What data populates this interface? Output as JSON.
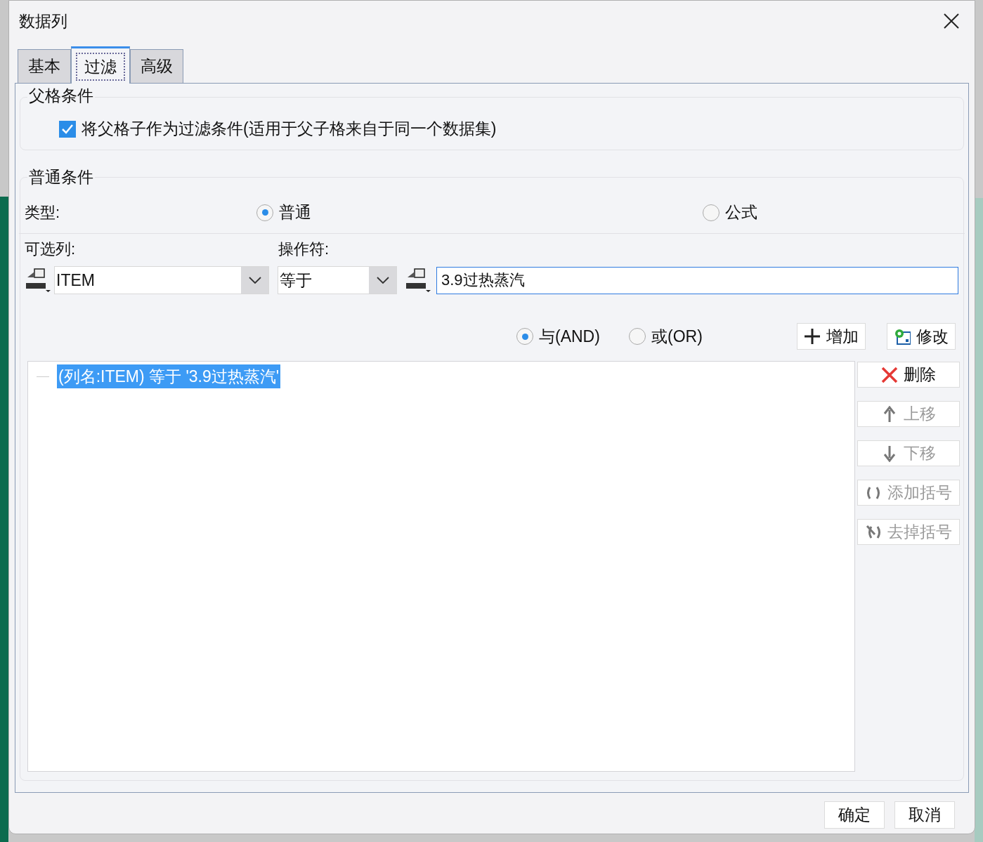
{
  "window": {
    "title": "数据列"
  },
  "tabs": [
    {
      "label": "基本",
      "selected": false
    },
    {
      "label": "过滤",
      "selected": true
    },
    {
      "label": "高级",
      "selected": false
    }
  ],
  "parent_condition": {
    "title": "父格条件",
    "checkbox": {
      "label": "将父格子作为过滤条件(适用于父子格来自于同一个数据集)",
      "checked": true
    }
  },
  "normal_condition": {
    "title": "普通条件",
    "type_label": "类型:",
    "type_options": [
      {
        "label": "普通",
        "selected": true
      },
      {
        "label": "公式",
        "selected": false
      }
    ],
    "column_label": "可选列:",
    "operator_label": "操作符:",
    "column": {
      "value": "ITEM"
    },
    "operator": {
      "value": "等于"
    },
    "value_field": {
      "value": "3.9过热蒸汽"
    },
    "logic_options": [
      {
        "label": "与(AND)",
        "selected": true
      },
      {
        "label": "或(OR)",
        "selected": false
      }
    ],
    "action_buttons": [
      {
        "kind": "add",
        "label": "增加",
        "disabled": false
      },
      {
        "kind": "edit",
        "label": "修改",
        "disabled": false
      }
    ],
    "conditions": [
      {
        "text": "(列名:ITEM) 等于 '3.9过热蒸汽'",
        "selected": true
      }
    ],
    "side_buttons": [
      {
        "kind": "delete",
        "label": "删除",
        "disabled": false
      },
      {
        "kind": "up",
        "label": "上移",
        "disabled": true
      },
      {
        "kind": "down",
        "label": "下移",
        "disabled": true
      },
      {
        "kind": "add_brackets",
        "label": "添加括号",
        "disabled": true
      },
      {
        "kind": "remove_brackets",
        "label": "去掉括号",
        "disabled": true
      }
    ]
  },
  "footer_buttons": [
    {
      "label": "确定"
    },
    {
      "label": "取消"
    }
  ]
}
